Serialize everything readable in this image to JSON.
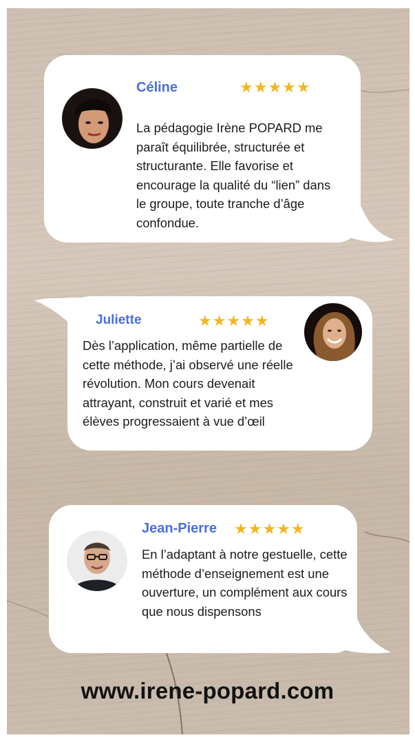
{
  "testimonials": [
    {
      "name": "Céline",
      "rating": 5,
      "stars": "★★★★★",
      "text": "La pédagogie Irène POPARD me paraît équilibrée, structurée et structurante. Elle favorise et encourage la qualité du “lien” dans le groupe, toute tranche d’âge confondue.",
      "avatar": "woman-portrait-avatar"
    },
    {
      "name": "Juliette",
      "rating": 5,
      "stars": "★★★★★",
      "text": "Dès l’application, même partielle de cette méthode, j’ai observé une réelle révolution. Mon cours devenait attrayant, construit et varié et mes élèves progressaient à vue d’œil",
      "avatar": "woman-smiling-avatar"
    },
    {
      "name": "Jean-Pierre",
      "rating": 5,
      "stars": "★★★★★",
      "text": "En l’adaptant à notre gestuelle, cette méthode d’enseignement est une ouverture, un complément aux cours que nous dispensons",
      "avatar": "man-glasses-avatar"
    }
  ],
  "footer": {
    "url": "www.irene-popard.com"
  },
  "colors": {
    "name": "#4a6fe0",
    "stars": "#f3b61f",
    "text": "#1c1c1c",
    "card": "#ffffff",
    "background": "#cdbfb1"
  }
}
